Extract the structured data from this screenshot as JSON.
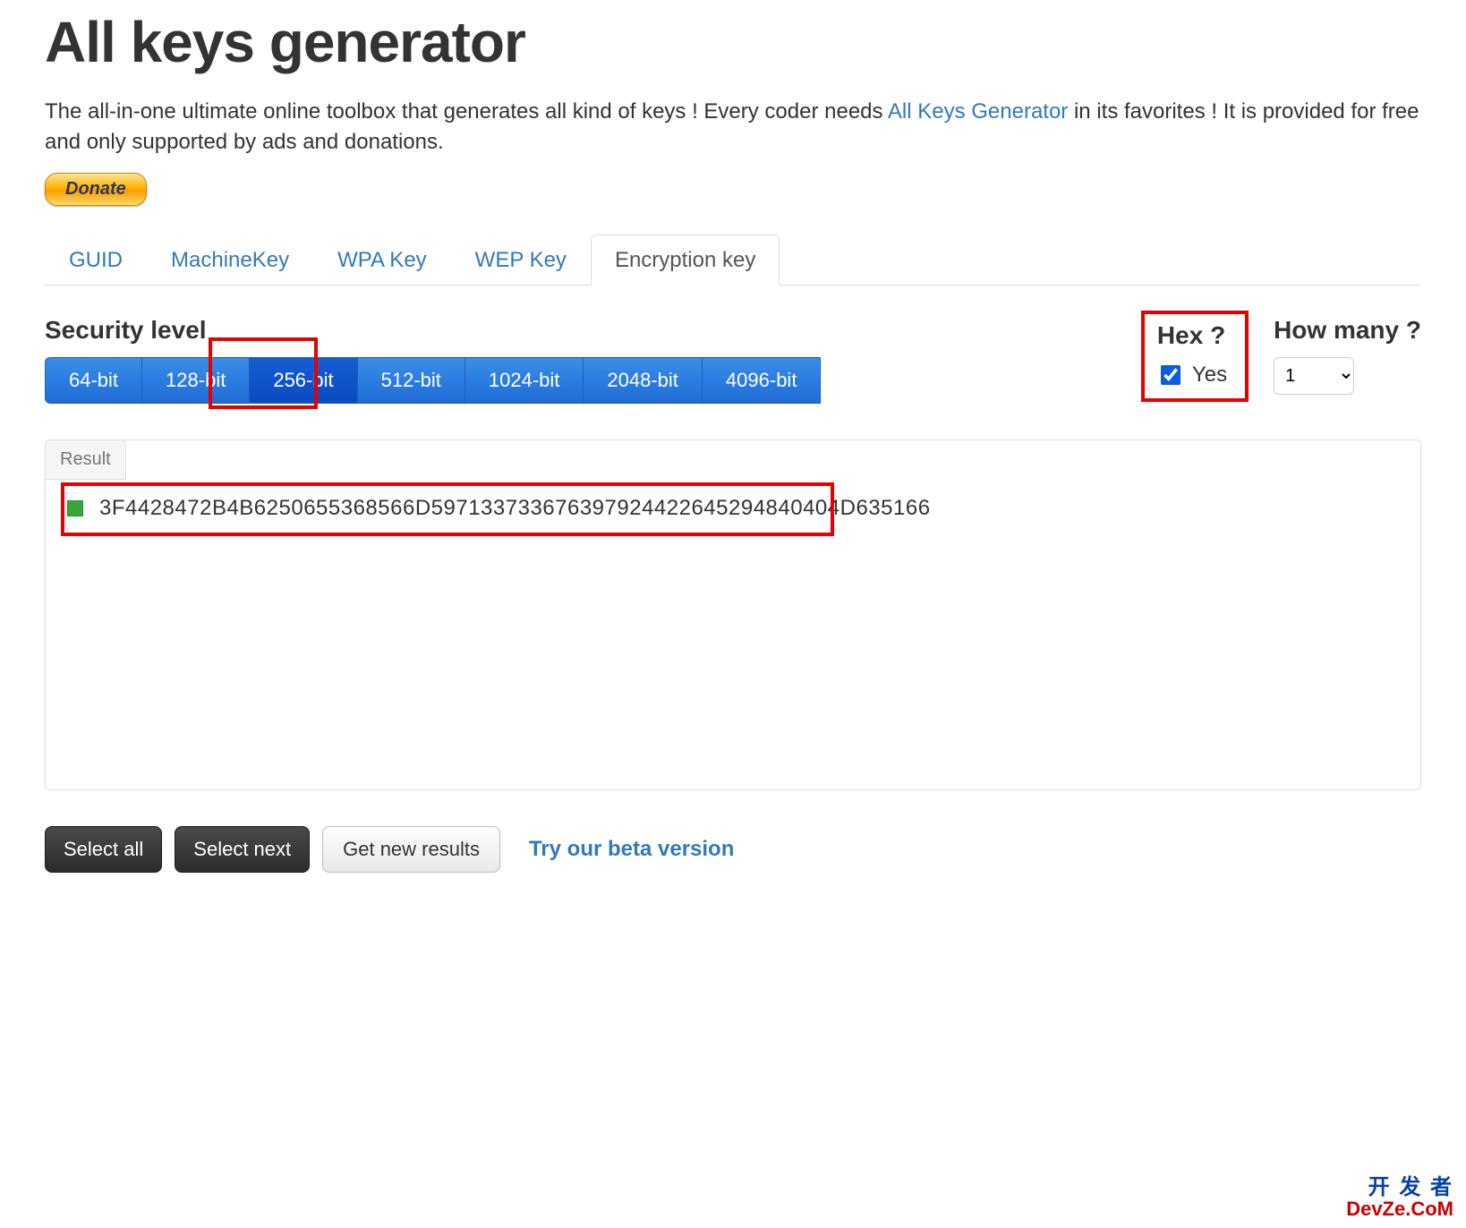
{
  "header": {
    "title": "All keys generator",
    "description_prefix": "The all-in-one ultimate online toolbox that generates all kind of keys ! Every coder needs ",
    "link_text": "All Keys Generator",
    "description_suffix": " in its favorites ! It is provided for free and only supported by ads and donations.",
    "donate_label": "Donate"
  },
  "tabs": {
    "items": [
      {
        "label": "GUID",
        "active": false
      },
      {
        "label": "MachineKey",
        "active": false
      },
      {
        "label": "WPA Key",
        "active": false
      },
      {
        "label": "WEP Key",
        "active": false
      },
      {
        "label": "Encryption key",
        "active": true
      }
    ]
  },
  "security": {
    "title": "Security level",
    "levels": [
      {
        "label": "64-bit",
        "selected": false
      },
      {
        "label": "128-bit",
        "selected": false
      },
      {
        "label": "256-bit",
        "selected": true
      },
      {
        "label": "512-bit",
        "selected": false
      },
      {
        "label": "1024-bit",
        "selected": false
      },
      {
        "label": "2048-bit",
        "selected": false
      },
      {
        "label": "4096-bit",
        "selected": false
      }
    ]
  },
  "hex": {
    "title": "Hex ?",
    "checkbox_label": "Yes",
    "checked": true
  },
  "howmany": {
    "title": "How many ?",
    "value": "1"
  },
  "result": {
    "tab_label": "Result",
    "keys": [
      "3F4428472B4B6250655368566D597133733676397924422645294840404D635166"
    ]
  },
  "footer": {
    "select_all": "Select all",
    "select_next": "Select next",
    "get_new": "Get new results",
    "beta": "Try our beta version"
  },
  "watermark": {
    "line1": "开 发 者",
    "line2": "DevZe.CoM"
  }
}
